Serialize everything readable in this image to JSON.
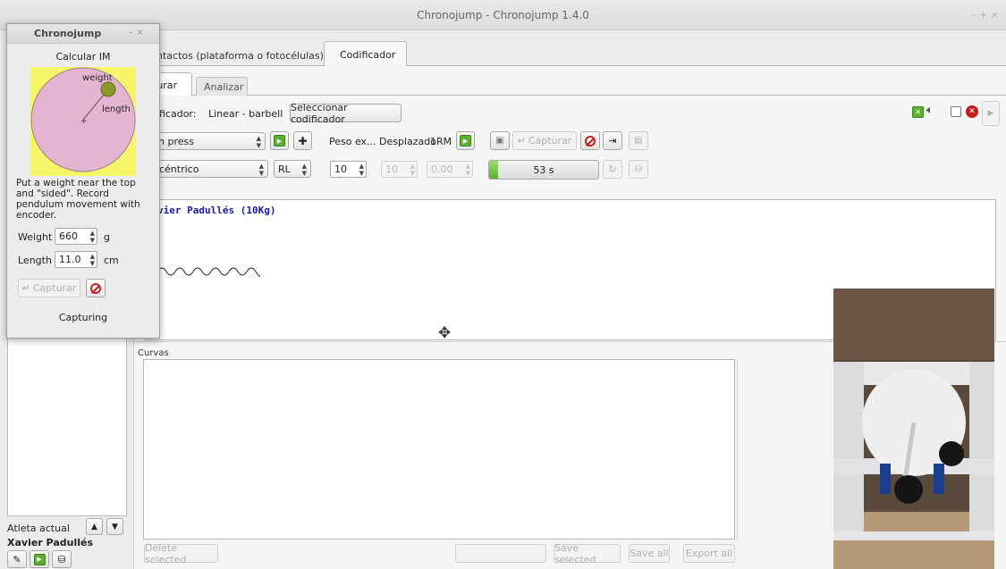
{
  "window": {
    "title": "Chronojump - Chronojump 1.4.0",
    "controls": "–  +  ×"
  },
  "main_tabs": [
    {
      "label": "ntactos (plataforma o fotocélulas)"
    },
    {
      "label": "Codificador"
    }
  ],
  "sub_tabs": [
    {
      "label": "turar"
    },
    {
      "label": "Analizar"
    }
  ],
  "encoder": {
    "label": "ficador:",
    "value": "Linear - barbell",
    "select_button": "Seleccionar codificador"
  },
  "row1": {
    "exercise": "ch press",
    "weight_labels": "Peso ex... Desplazado",
    "rm_label": "1RM",
    "capture_button": "Capturar"
  },
  "row2": {
    "contraction": "ncéntrico",
    "laterality": "RL",
    "spin_a": "10",
    "spin_b": "10",
    "spin_c": "0,00",
    "time_label": "53 s",
    "progress": 0.08
  },
  "graph": {
    "frame_label": "l",
    "athlete_label": "vier Padullés (10Kg)"
  },
  "curves": {
    "label": "Curvas",
    "buttons": {
      "delete": "Delete selected",
      "save_selected": "Save selected",
      "save_all": "Save all",
      "export_all": "Export all"
    }
  },
  "sidebar": {
    "current_label": "Atleta actual",
    "athlete": "Xavier Padullés"
  },
  "dialog": {
    "title": "Chronojump",
    "controls": "–  ×",
    "heading": "Calcular IM",
    "diagram_weight": "weight",
    "diagram_length": "length",
    "instructions": "Put a weight near the top and \"sided\". Record pendulum movement with encoder.",
    "weight_label": "Weight",
    "weight_value": "660",
    "weight_unit": "g",
    "length_label": "Length",
    "length_value": "11.0",
    "length_unit": "cm",
    "capture_button": "Capturar",
    "status": "Capturing"
  },
  "colors": {
    "athlete_blue": "#1a1aa0",
    "accent_green": "#5cb030",
    "stop_red": "#c41d1d",
    "pendulum_pink": "#e4b4d0",
    "pendulum_bg": "#f5f56a"
  }
}
